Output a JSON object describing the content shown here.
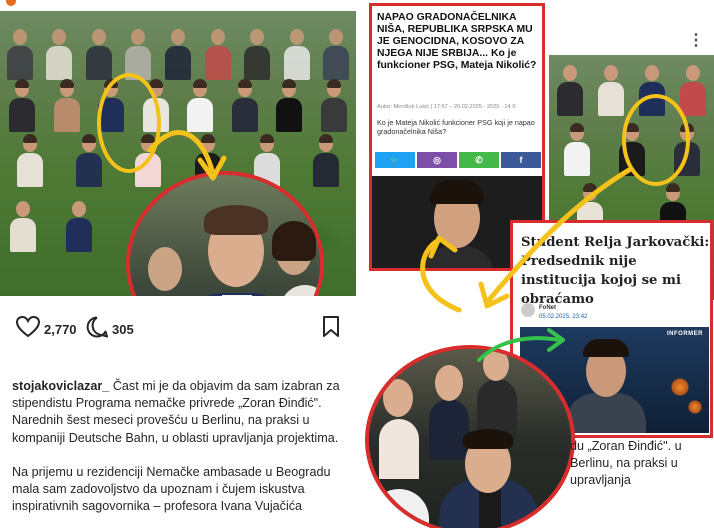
{
  "left_post": {
    "likes": "2,770",
    "comments": "305",
    "username": "stojakoviclazar_",
    "caption_p1": "Čast mi je da objavim da sam izabran za stipendistu Programa nemačke privrede „Zoran Đinđić\". Narednih šest meseci provešću u Berlinu, na praksi u kompaniji Deutsche Bahn, u oblasti upravljanja projektima.",
    "caption_p2": "Na prijemu u rezidenciji Nemačke ambasade u Beogradu mala sam zadovoljstvo da upoznam i čujem iskustva inspirativnih sagovornika – profesora Ivana Vujačića"
  },
  "article": {
    "headline": "NAPAO GRADONAČELNIKA NIŠA, REPUBLIKA SRPSKA MU JE GENOCIDNA, KOSOVO ZA NJEGA NIJE SRBIJA... Ko je funkcioner PSG, Mateja Nikolić?",
    "meta": "Autor: Mirošlub Lukić  |  17:57 – 20.02.2025 · 2025 · 14 ©",
    "lead": "Ko je Mateja Nikolić funkcioner PSG koji je napao gradonačelnika Niša?",
    "share_buttons": [
      {
        "icon": "twitter-icon",
        "glyph": "🐦",
        "color": "#1da1f2"
      },
      {
        "icon": "viber-icon",
        "glyph": "◎",
        "color": "#7d4fa8"
      },
      {
        "icon": "whatsapp-icon",
        "glyph": "✆",
        "color": "#45b94a"
      },
      {
        "icon": "facebook-icon",
        "glyph": "f",
        "color": "#3b5998"
      }
    ]
  },
  "quote_card": {
    "headline": "Student Relja Jarkovački: Predsednik nije institucija kojoj se mi obraćamo",
    "source": "FoNet",
    "date": "05.02.2025. 23:42",
    "tv_logo": "INFORMER"
  },
  "right_caption": "du „Zoran Đinđić\". u Berlinu, na praksi u upravljanja",
  "colors": {
    "highlight_red": "#d92d2d",
    "annotation_yellow": "#f4c21a",
    "annotation_green": "#35c24a"
  }
}
